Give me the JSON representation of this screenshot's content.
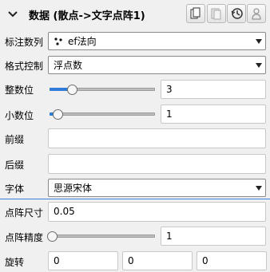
{
  "header": {
    "title": "数据 (散点->文字点阵1)",
    "collapse_icon": "chevron-down-icon",
    "buttons": [
      {
        "icon": "copy-icon"
      },
      {
        "icon": "paste-icon"
      },
      {
        "icon": "history-icon"
      },
      {
        "icon": "user-icon"
      }
    ]
  },
  "rows": {
    "label_series": {
      "label": "标注数列",
      "value": "ef法向",
      "icon": "scatter-dots-icon"
    },
    "format": {
      "label": "格式控制",
      "value": "浮点数"
    },
    "int_digits": {
      "label": "整数位",
      "value": "3",
      "slider_fraction": 0.19
    },
    "dec_digits": {
      "label": "小数位",
      "value": "1",
      "slider_fraction": 0.06
    },
    "prefix": {
      "label": "前缀",
      "value": ""
    },
    "suffix": {
      "label": "后缀",
      "value": ""
    },
    "font": {
      "label": "字体",
      "value": "思源宋体"
    },
    "dot_size": {
      "label": "点阵尺寸",
      "value": "0.05"
    },
    "dot_precision": {
      "label": "点阵精度",
      "value": "1",
      "slider_fraction": 0.0
    },
    "rotation": {
      "label": "旋转",
      "values": [
        "0",
        "0",
        "0"
      ]
    }
  },
  "colors": {
    "accent": "#2f7bd6",
    "focus": "#3c7fd6"
  }
}
